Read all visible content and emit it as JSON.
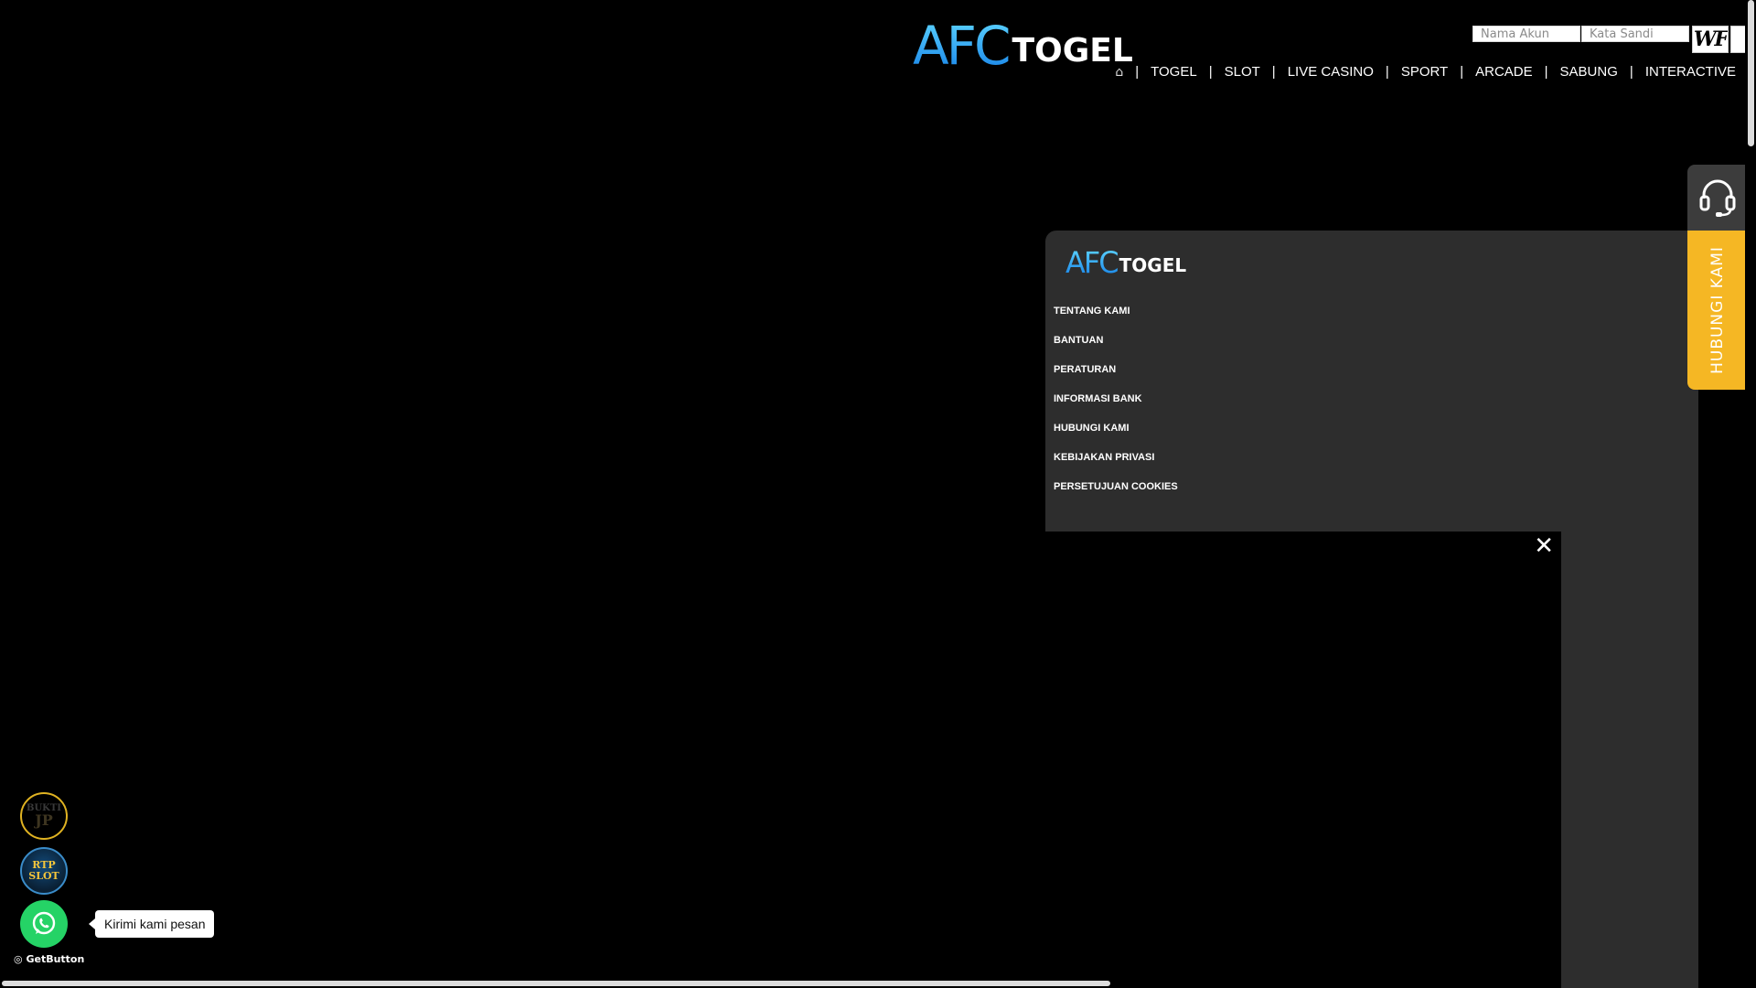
{
  "brand": {
    "logo_part1": "AFC",
    "logo_part2": "TOGEL"
  },
  "login": {
    "username_placeholder": "Nama Akun",
    "password_placeholder": "Kata Sandi",
    "captcha_text": "WF"
  },
  "nav": {
    "home_icon": "home-icon",
    "items": [
      "TOGEL",
      "SLOT",
      "LIVE CASINO",
      "SPORT",
      "ARCADE",
      "SABUNG",
      "INTERACTIVE"
    ]
  },
  "footer": {
    "logo_part1": "AFC",
    "logo_part2": "TOGEL",
    "links": [
      "TENTANG KAMI",
      "BANTUAN",
      "PERATURAN",
      "INFORMASI BANK",
      "HUBUNGI KAMI",
      "KEBIJAKAN PRIVASI",
      "PERSETUJUAN COOKIES"
    ]
  },
  "video": {
    "close_glyph": "✕"
  },
  "contact_tab": {
    "label": "HUBUNGI KAMI",
    "icon": "headset-icon"
  },
  "floating": {
    "bukti_line1": "BUKTI",
    "bukti_line2": "JP",
    "rtp_line1": "RTP",
    "rtp_line2": "SLOT",
    "whatsapp_tooltip": "Kirimi kami pesan",
    "getbutton_label": "GetButton"
  },
  "colors": {
    "background": "#000000",
    "panel": "#2d2d2d",
    "contact_accent": "#f5b724",
    "whatsapp": "#25d366",
    "logo_blue": "#1a86e8"
  }
}
